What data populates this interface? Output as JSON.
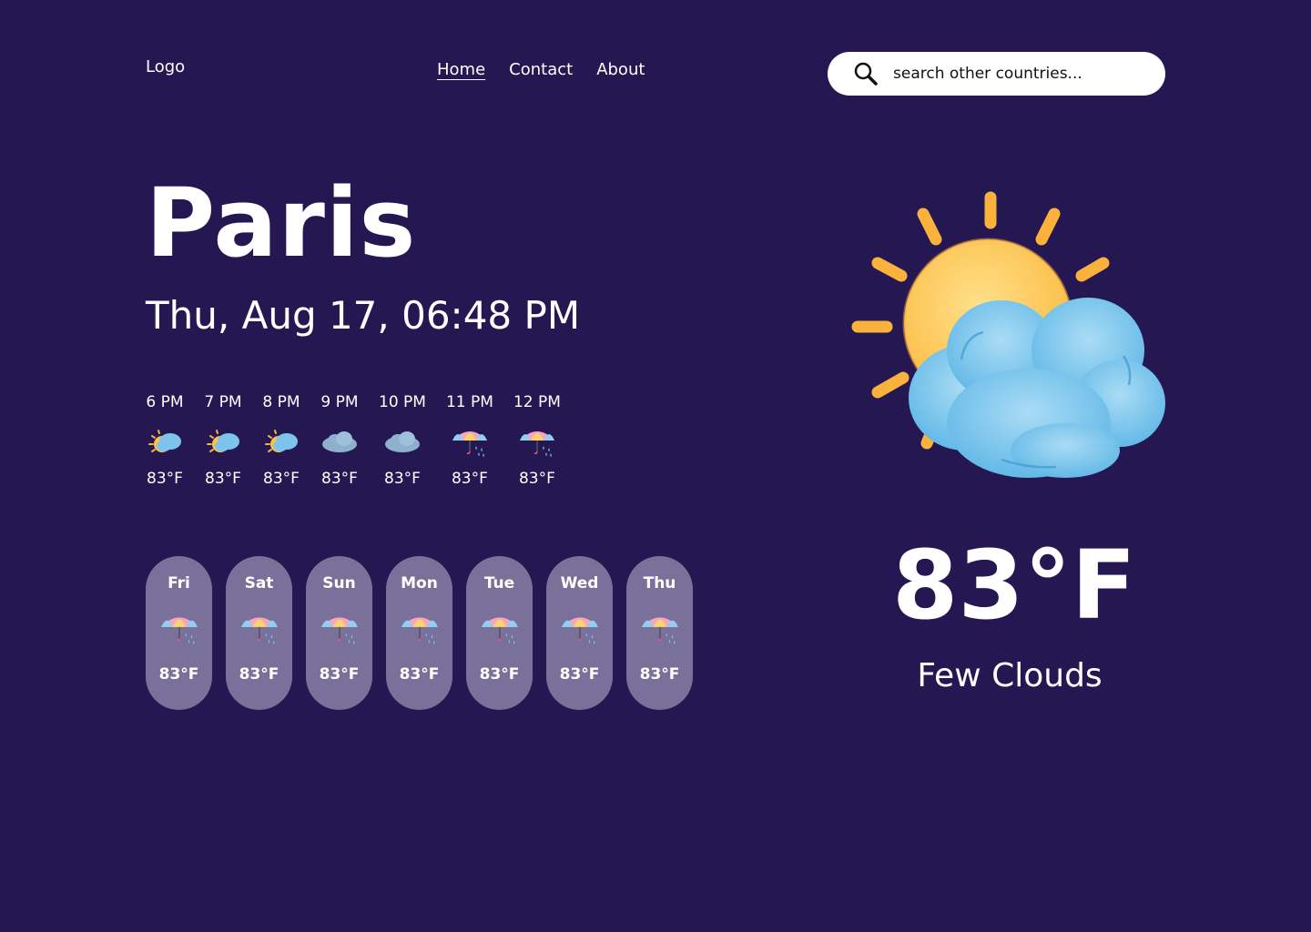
{
  "header": {
    "logo": "Logo",
    "nav": [
      {
        "label": "Home",
        "active": true
      },
      {
        "label": "Contact",
        "active": false
      },
      {
        "label": "About",
        "active": false
      }
    ],
    "search": {
      "placeholder": "search other countries...",
      "icon": "search-icon"
    }
  },
  "current": {
    "city": "Paris",
    "datetime": "Thu, Aug 17, 06:48 PM",
    "temperature": "83°F",
    "condition": "Few Clouds",
    "icon": "sun-cloud-icon"
  },
  "hourly": [
    {
      "time": "6 PM",
      "temp": "83°F",
      "icon": "sun-cloud-icon"
    },
    {
      "time": "7 PM",
      "temp": "83°F",
      "icon": "sun-cloud-icon"
    },
    {
      "time": "8 PM",
      "temp": "83°F",
      "icon": "sun-cloud-icon"
    },
    {
      "time": "9 PM",
      "temp": "83°F",
      "icon": "cloud-icon"
    },
    {
      "time": "10 PM",
      "temp": "83°F",
      "icon": "cloud-icon"
    },
    {
      "time": "11 PM",
      "temp": "83°F",
      "icon": "umbrella-rain-icon"
    },
    {
      "time": "12 PM",
      "temp": "83°F",
      "icon": "umbrella-rain-icon"
    }
  ],
  "daily": [
    {
      "day": "Fri",
      "temp": "83°F",
      "icon": "umbrella-rain-icon"
    },
    {
      "day": "Sat",
      "temp": "83°F",
      "icon": "umbrella-rain-icon"
    },
    {
      "day": "Sun",
      "temp": "83°F",
      "icon": "umbrella-rain-icon"
    },
    {
      "day": "Mon",
      "temp": "83°F",
      "icon": "umbrella-rain-icon"
    },
    {
      "day": "Tue",
      "temp": "83°F",
      "icon": "umbrella-rain-icon"
    },
    {
      "day": "Wed",
      "temp": "83°F",
      "icon": "umbrella-rain-icon"
    },
    {
      "day": "Thu",
      "temp": "83°F",
      "icon": "umbrella-rain-icon"
    }
  ],
  "colors": {
    "background": "#251852",
    "day_card": "#7a719a",
    "sun": "#fcc24a",
    "cloud": "#6fc0ea"
  }
}
